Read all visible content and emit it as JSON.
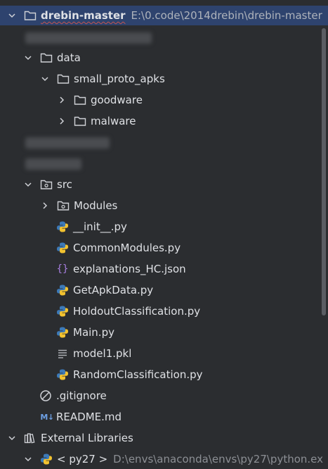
{
  "tree": {
    "root": {
      "label": "drebin-master",
      "path": "E:\\0.code\\2014drebin\\drebin-master"
    },
    "data_folder": "data",
    "small_proto_apks": "small_proto_apks",
    "goodware": "goodware",
    "malware": "malware",
    "src_folder": "src",
    "modules_folder": "Modules",
    "files": {
      "init": "__init__.py",
      "common_modules": "CommonModules.py",
      "explanations": "explanations_HC.json",
      "get_apk_data": "GetApkData.py",
      "holdout": "HoldoutClassification.py",
      "main": "Main.py",
      "model1": "model1.pkl",
      "random_classification": "RandomClassification.py"
    },
    "gitignore": ".gitignore",
    "readme": "README.md",
    "readme_badge": "M↓",
    "external_libraries": "External Libraries",
    "python_env": {
      "label": "< py27 >",
      "path": "D:\\envs\\anaconda\\envs\\py27\\python.ex"
    }
  },
  "colors": {
    "selection": "#2e436e",
    "background": "#2b2d30",
    "text": "#dfe1e5",
    "python_blue": "#3d7ab8",
    "python_yellow": "#f2c230"
  }
}
